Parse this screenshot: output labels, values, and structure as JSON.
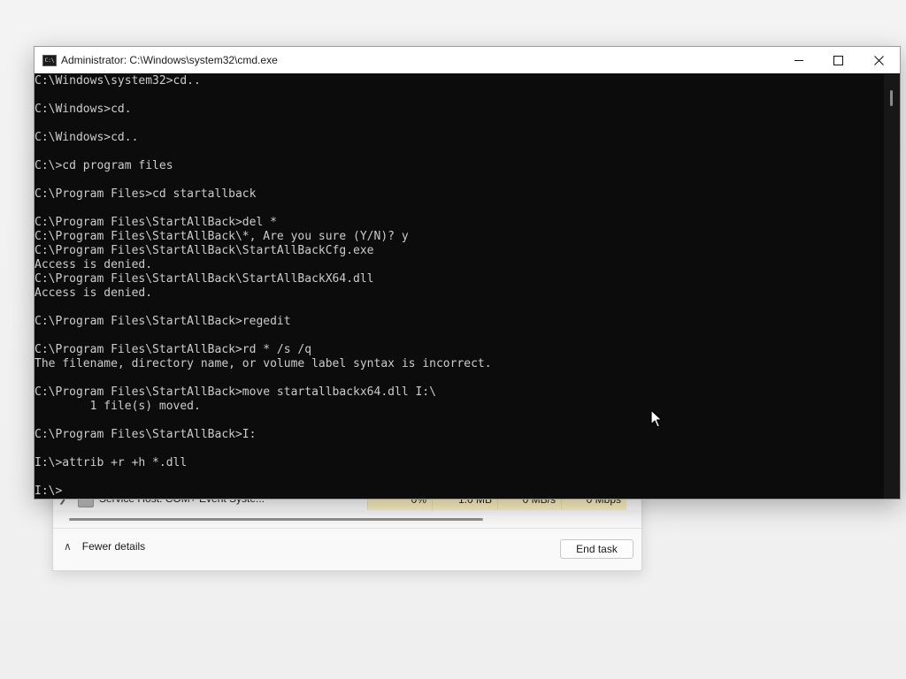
{
  "taskmanager": {
    "process_name": "Service Host: COM+ Event Syste...",
    "cpu": "0%",
    "memory": "1.0 MB",
    "disk": "0 MB/s",
    "network": "0 Mbps",
    "fewer_details": "Fewer details",
    "end_task": "End task"
  },
  "cmd": {
    "title": "Administrator: C:\\Windows\\system32\\cmd.exe",
    "icon_label": "C:\\",
    "lines": [
      "C:\\Windows\\system32>cd..",
      "",
      "C:\\Windows>cd.",
      "",
      "C:\\Windows>cd..",
      "",
      "C:\\>cd program files",
      "",
      "C:\\Program Files>cd startallback",
      "",
      "C:\\Program Files\\StartAllBack>del *",
      "C:\\Program Files\\StartAllBack\\*, Are you sure (Y/N)? y",
      "C:\\Program Files\\StartAllBack\\StartAllBackCfg.exe",
      "Access is denied.",
      "C:\\Program Files\\StartAllBack\\StartAllBackX64.dll",
      "Access is denied.",
      "",
      "C:\\Program Files\\StartAllBack>regedit",
      "",
      "C:\\Program Files\\StartAllBack>rd * /s /q",
      "The filename, directory name, or volume label syntax is incorrect.",
      "",
      "C:\\Program Files\\StartAllBack>move startallbackx64.dll I:\\",
      "        1 file(s) moved.",
      "",
      "C:\\Program Files\\StartAllBack>I:",
      "",
      "I:\\>attrib +r +h *.dll",
      "",
      "I:\\>"
    ]
  },
  "icons": {
    "cmd_window_icon": "cmd-icon",
    "minimize": "minimize-icon",
    "maximize": "maximize-icon",
    "close": "close-icon",
    "expand": "chevron-right-icon",
    "collapse": "chevron-up-icon",
    "process": "service-host-icon",
    "cursor": "mouse-pointer-icon"
  },
  "colors": {
    "console_bg": "#0c0c0c",
    "console_fg": "#cccccc",
    "highlight_cell": "#fff4c4"
  }
}
